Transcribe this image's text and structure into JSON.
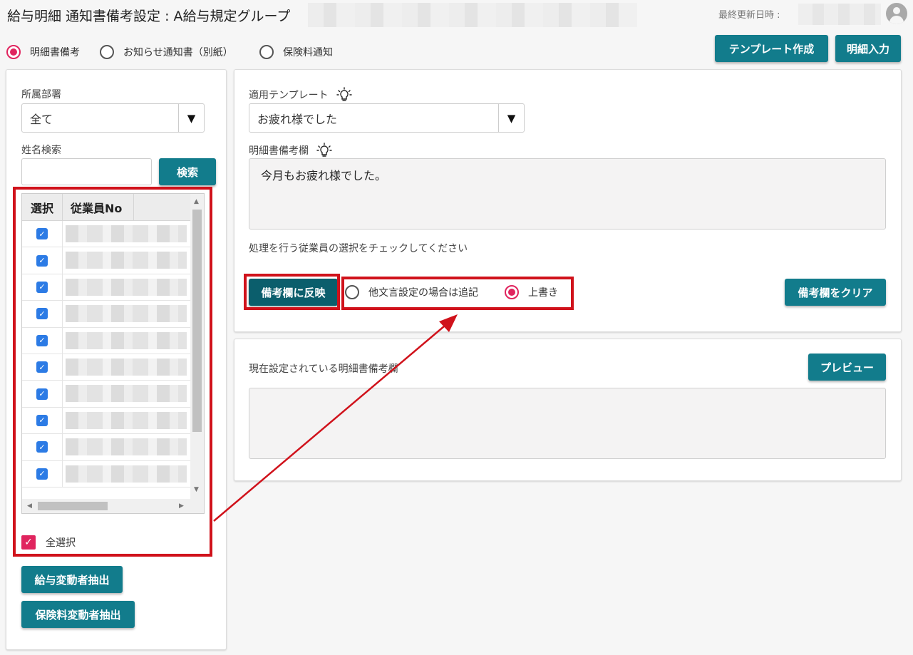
{
  "header": {
    "title": "給与明細 通知書備考設定 : A給与規定グループ",
    "last_updated_label": "最終更新日時 :"
  },
  "mode_options": [
    {
      "label": "明細書備考",
      "selected": true
    },
    {
      "label": "お知らせ通知書（別紙）",
      "selected": false
    },
    {
      "label": "保険料通知",
      "selected": false
    }
  ],
  "toolbar": {
    "template_create": "テンプレート作成",
    "detail_input": "明細入力"
  },
  "filters": {
    "department_label": "所属部署",
    "department_value": "全て",
    "name_search_label": "姓名検索",
    "name_search_value": "",
    "search_button": "検索"
  },
  "employee_grid": {
    "columns": [
      "選択",
      "従業員No"
    ],
    "rows_checked": [
      true,
      true,
      true,
      true,
      true,
      true,
      true,
      true,
      true,
      true
    ]
  },
  "select_all": {
    "label": "全選択",
    "checked": true
  },
  "extract_buttons": {
    "salary_change": "給与変動者抽出",
    "insurance_change": "保険料変動者抽出"
  },
  "settings": {
    "template_label": "適用テンプレート",
    "template_value": "お疲れ様でした",
    "remarks_label": "明細書備考欄",
    "remarks_value": "今月もお疲れ様でした。",
    "instruction": "処理を行う従業員の選択をチェックしてください",
    "apply_button": "備考欄に反映",
    "append_option": "他文言設定の場合は追記",
    "overwrite_option": "上書き",
    "overwrite_selected": true,
    "clear_button": "備考欄をクリア"
  },
  "current": {
    "label": "現在設定されている明細書備考欄",
    "preview_button": "プレビュー",
    "value": ""
  },
  "colors": {
    "primary_button": "#127c8c",
    "primary_button_dark": "#0b5e6c",
    "radio_accent": "#e0245e",
    "checkbox_blue": "#2c7be5",
    "annotation_red": "#d0121b"
  },
  "icons": {
    "hint": "lightbulb-icon",
    "avatar": "user-avatar-icon",
    "dropdown": "triangle-down-icon"
  }
}
